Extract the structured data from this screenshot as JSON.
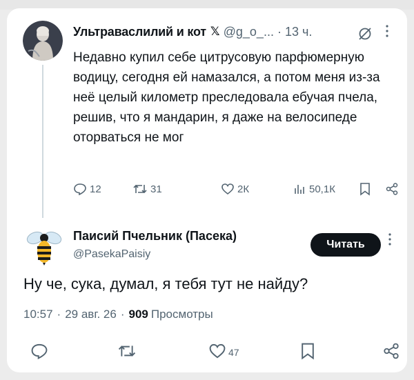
{
  "tweet1": {
    "display_name": "Ультраваслилий и кот",
    "x_badge": "𝕏",
    "handle": "@g_o_...",
    "dot": "·",
    "time": "13 ч.",
    "text": "Недавно купил себе цитрусовую парфюмерную водицу, сегодня ей намазался, а потом меня из-за неё целый километр преследовала ебучая пчела, решив, что я мандарин, я даже на велосипеде оторваться не мог",
    "replies": "12",
    "reposts": "31",
    "likes": "2К",
    "views": "50,1К"
  },
  "tweet2": {
    "display_name": "Паисий Пчельник (Пасека)",
    "handle": "@PasekaPaisiy",
    "follow_button": "Читать",
    "text": "Ну че, сука, думал, я тебя тут не найду?",
    "time": "10:57",
    "date": "29 авг. 26",
    "views_count": "909",
    "views_label": "Просмотры",
    "likes": "47"
  },
  "icons": [
    "grok-icon",
    "more-icon",
    "reply-icon",
    "repost-icon",
    "like-icon",
    "views-icon",
    "bookmark-icon",
    "share-icon"
  ],
  "colors": {
    "text": "#0f1419",
    "muted": "#536471",
    "button_bg": "#0f1419",
    "thread_line": "#cfd9de"
  }
}
